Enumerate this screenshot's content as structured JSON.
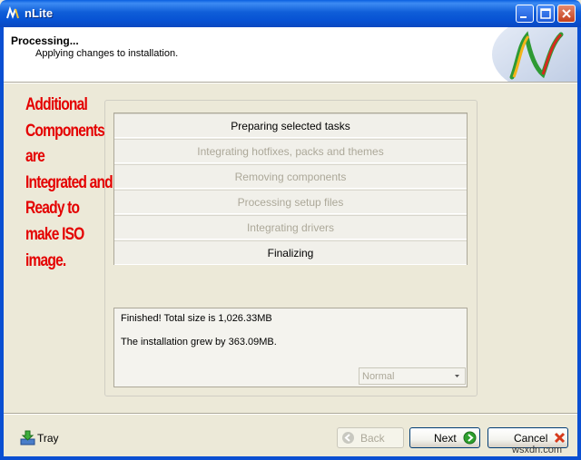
{
  "window": {
    "title": "nLite",
    "icons": {
      "app": "nlite-icon",
      "minimize": "minimize-icon",
      "maximize": "maximize-icon",
      "close": "close-icon"
    }
  },
  "header": {
    "title": "Processing...",
    "subtitle": "Applying changes to installation.",
    "logo": "nlite-logo"
  },
  "annotation": {
    "lines": [
      "Additional",
      "Components",
      "are",
      "Integrated and",
      "Ready to",
      "make ISO",
      "image."
    ],
    "color": "#e40000"
  },
  "tasks": [
    {
      "label": "Preparing selected tasks",
      "state": "active"
    },
    {
      "label": "Integrating hotfixes, packs and themes",
      "state": "inactive"
    },
    {
      "label": "Removing components",
      "state": "inactive"
    },
    {
      "label": "Processing setup files",
      "state": "inactive"
    },
    {
      "label": "Integrating drivers",
      "state": "inactive"
    },
    {
      "label": "Finalizing",
      "state": "active"
    }
  ],
  "log": {
    "line1": "Finished! Total size is 1,026.33MB",
    "line2": "The installation grew by 363.09MB.",
    "priority_select": {
      "value": "Normal",
      "icon": "chevron-down-icon"
    }
  },
  "footer": {
    "tray_label": "Tray",
    "tray_icon": "tray-download-icon",
    "back_label": "Back",
    "back_icon": "back-arrow-icon",
    "next_label": "Next",
    "next_icon": "next-arrow-icon",
    "cancel_label": "Cancel",
    "cancel_icon": "cancel-x-icon",
    "watermark": "wsxdn.com"
  },
  "colors": {
    "title_bar": "#0a52d6",
    "accent_green": "#2ea02e",
    "cancel_red": "#d63a1c"
  }
}
